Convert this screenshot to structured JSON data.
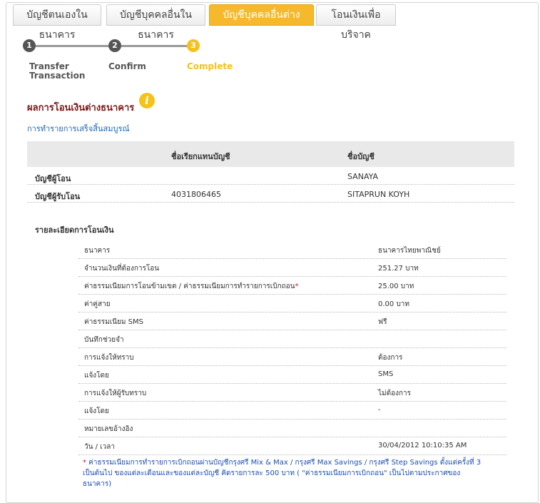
{
  "tabs": [
    {
      "label": "บัญชีตนเองในธนาคาร",
      "active": false
    },
    {
      "label": "บัญชีบุคคลอื่นในธนาคาร",
      "active": false
    },
    {
      "label": "บัญชีบุคคลอื่นต่างธนาคาร",
      "active": true
    },
    {
      "label": "โอนเงินเพื่อบริจาค",
      "active": false
    }
  ],
  "steps": [
    {
      "num": "1",
      "label1": "Transfer",
      "label2": "Transaction",
      "color": "#555555"
    },
    {
      "num": "2",
      "label1": "Confirm",
      "label2": "",
      "color": "#555555"
    },
    {
      "num": "3",
      "label1": "Complete",
      "label2": "",
      "color": "#f5c21a"
    }
  ],
  "title": "ผลการโอนเงินต่างธนาคาร",
  "info_icon": "i",
  "subtitle": "การทำรายการเสร็จสิ้นสมบูรณ์",
  "account_table": {
    "headers": [
      "",
      "ชื่อเรียกแทนบัญชี",
      "ชื่อบัญชี"
    ],
    "rows": [
      {
        "label": "บัญชีผู้โอน",
        "nickname": "",
        "name": "SANAYA"
      },
      {
        "label": "บัญชีผู้รับโอน",
        "nickname": "4031806465",
        "name": "SITAPRUN KOYH"
      }
    ]
  },
  "detail_heading": "รายละเอียดการโอนเงิน",
  "details": [
    {
      "label": "ธนาคาร",
      "value": "ธนาคารไทยพาณิชย์"
    },
    {
      "label": "จำนวนเงินที่ต้องการโอน",
      "value": "251.27 บาท"
    },
    {
      "label": "ค่าธรรมเนียมการโอนข้ามเขต / ค่าธรรมเนียมการทำรายการเบิกถอน",
      "star": "*",
      "value": "25.00 บาท"
    },
    {
      "label": "ค่าคู่สาย",
      "value": "0.00 บาท"
    },
    {
      "label": "ค่าธรรมเนียม SMS",
      "value": "ฟรี"
    },
    {
      "label": "บันทึกช่วยจำ",
      "value": ""
    },
    {
      "label": "การแจ้งให้ทราบ",
      "value": "ต้องการ"
    },
    {
      "label": "แจ้งโดย",
      "value": "SMS"
    },
    {
      "label": "การแจ้งให้ผู้รับทราบ",
      "value": "ไม่ต้องการ"
    },
    {
      "label": "แจ้งโดย",
      "value": "-"
    },
    {
      "label": "หมายเลขอ้างอิง",
      "value": ""
    },
    {
      "label": "วัน / เวลา",
      "value": "30/04/2012 10:10:35 AM"
    }
  ],
  "note_star": "*",
  "note": " ค่าธรรมเนียมการทำรายการเบิกถอนผ่านบัญชีกรุงศรี Mix & Max / กรุงศรี Max Savings / กรุงศรี Step Savings ตั้งแต่ครั้งที่ 3 เป็นต้นไป ของแต่ละเดือนและของแต่ละบัญชี คิดรายการละ 500 บาท ( \"ค่าธรรมเนียมการเบิกถอน\" เป็นไปตามประกาศของธนาคาร)",
  "colors": {
    "accent": "#f6b92b",
    "title": "#7b1818",
    "link": "#1a66b8"
  }
}
